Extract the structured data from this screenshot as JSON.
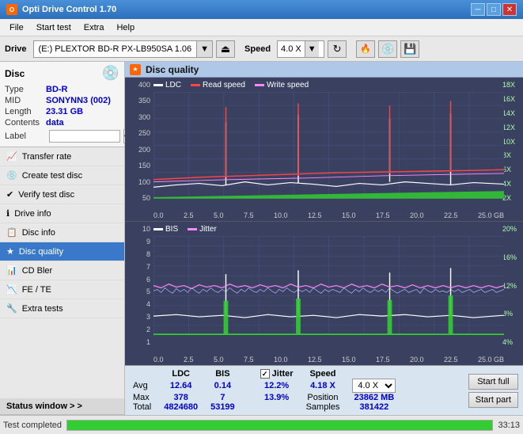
{
  "titlebar": {
    "title": "Opti Drive Control 1.70",
    "icon": "O",
    "minimize": "─",
    "maximize": "□",
    "close": "✕"
  },
  "menubar": {
    "items": [
      "File",
      "Start test",
      "Extra",
      "Help"
    ]
  },
  "drive_toolbar": {
    "drive_label": "Drive",
    "drive_value": "(E:)  PLEXTOR BD-R  PX-LB950SA 1.06",
    "speed_label": "Speed",
    "speed_value": "4.0 X"
  },
  "disc": {
    "label": "Disc",
    "type_key": "Type",
    "type_val": "BD-R",
    "mid_key": "MID",
    "mid_val": "SONYNN3 (002)",
    "length_key": "Length",
    "length_val": "23.31 GB",
    "contents_key": "Contents",
    "contents_val": "data",
    "label_key": "Label"
  },
  "nav": {
    "items": [
      {
        "id": "transfer-rate",
        "label": "Transfer rate",
        "icon": "📈"
      },
      {
        "id": "create-test-disc",
        "label": "Create test disc",
        "icon": "💿"
      },
      {
        "id": "verify-test-disc",
        "label": "Verify test disc",
        "icon": "✔"
      },
      {
        "id": "drive-info",
        "label": "Drive info",
        "icon": "ℹ"
      },
      {
        "id": "disc-info",
        "label": "Disc info",
        "icon": "📋"
      },
      {
        "id": "disc-quality",
        "label": "Disc quality",
        "icon": "★",
        "active": true
      },
      {
        "id": "cd-bler",
        "label": "CD Bler",
        "icon": "📊"
      },
      {
        "id": "fe-te",
        "label": "FE / TE",
        "icon": "📉"
      },
      {
        "id": "extra-tests",
        "label": "Extra tests",
        "icon": "🔧"
      }
    ],
    "status_window": "Status window > >"
  },
  "chart": {
    "title": "Disc quality",
    "top": {
      "legend": [
        {
          "label": "LDC",
          "color": "#ffffff"
        },
        {
          "label": "Read speed",
          "color": "#ff2222"
        },
        {
          "label": "Write speed",
          "color": "#ff44ff"
        }
      ],
      "y_left": [
        "400",
        "350",
        "300",
        "250",
        "200",
        "150",
        "100",
        "50"
      ],
      "y_right": [
        "18X",
        "16X",
        "14X",
        "12X",
        "10X",
        "8X",
        "6X",
        "4X",
        "2X"
      ],
      "x_labels": [
        "0.0",
        "2.5",
        "5.0",
        "7.5",
        "10.0",
        "12.5",
        "15.0",
        "17.5",
        "20.0",
        "22.5",
        "25.0 GB"
      ]
    },
    "bottom": {
      "legend": [
        {
          "label": "BIS",
          "color": "#ffffff"
        },
        {
          "label": "Jitter",
          "color": "#ff44ff"
        }
      ],
      "y_left": [
        "10",
        "9",
        "8",
        "7",
        "6",
        "5",
        "4",
        "3",
        "2",
        "1"
      ],
      "y_right": [
        "20%",
        "16%",
        "12%",
        "8%",
        "4%"
      ],
      "x_labels": [
        "0.0",
        "2.5",
        "5.0",
        "7.5",
        "10.0",
        "12.5",
        "15.0",
        "17.5",
        "20.0",
        "22.5",
        "25.0 GB"
      ]
    }
  },
  "stats": {
    "headers": [
      "",
      "LDC",
      "BIS",
      "",
      "Jitter",
      "Speed",
      ""
    ],
    "avg_label": "Avg",
    "avg_ldc": "12.64",
    "avg_bis": "0.14",
    "avg_jitter": "12.2%",
    "max_label": "Max",
    "max_ldc": "378",
    "max_bis": "7",
    "max_jitter": "13.9%",
    "total_label": "Total",
    "total_ldc": "4824680",
    "total_bis": "53199",
    "position_label": "Position",
    "position_val": "23862 MB",
    "samples_label": "Samples",
    "samples_val": "381422",
    "speed_val": "4.18 X",
    "speed_select": "4.0 X",
    "start_full": "Start full",
    "start_part": "Start part"
  },
  "statusbar": {
    "text": "Test completed",
    "progress": 100,
    "time": "33:13"
  }
}
